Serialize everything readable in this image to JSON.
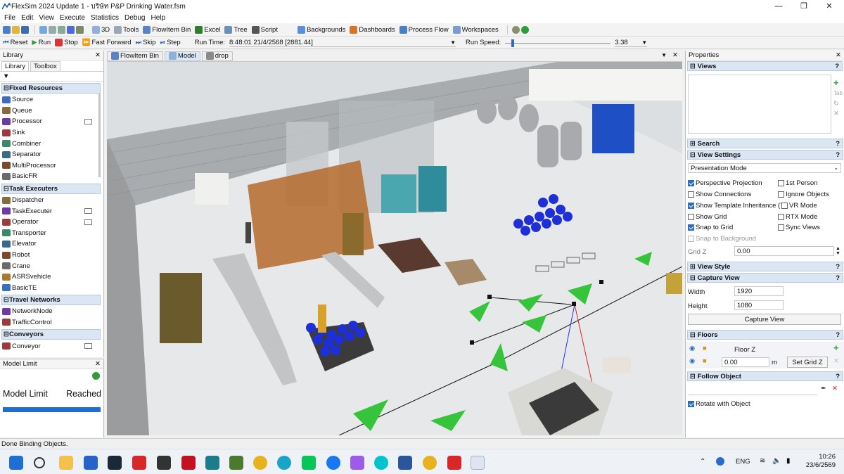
{
  "window": {
    "title": "FlexSim 2024 Update 1 - บริษัท P&P Drinking Water.fsm"
  },
  "menu": [
    "File",
    "Edit",
    "View",
    "Execute",
    "Statistics",
    "Debug",
    "Help"
  ],
  "toolbar1": {
    "items": [
      "3D",
      "Tools",
      "FlowItem Bin",
      "Excel",
      "Tree",
      "Script",
      "Backgrounds",
      "Dashboards",
      "Process Flow",
      "Workspaces"
    ]
  },
  "toolbar2": {
    "reset": "Reset",
    "run": "Run",
    "stop": "Stop",
    "fast_forward": "Fast Forward",
    "skip": "Skip",
    "step": "Step",
    "run_time_label": "Run Time:",
    "run_time_value": "8:48:01  21/4/2568 [2881.44]",
    "run_speed_label": "Run Speed:",
    "run_speed_value": "3.38"
  },
  "library": {
    "title": "Library",
    "tabs": [
      "Library",
      "Toolbox"
    ],
    "groups": [
      {
        "name": "Fixed Resources",
        "items": [
          "Source",
          "Queue",
          "Processor",
          "Sink",
          "Combiner",
          "Separator",
          "MultiProcessor",
          "BasicFR"
        ]
      },
      {
        "name": "Task Executers",
        "items": [
          "Dispatcher",
          "TaskExecuter",
          "Operator",
          "Transporter",
          "Elevator",
          "Robot",
          "Crane",
          "ASRSvehicle",
          "BasicTE"
        ]
      },
      {
        "name": "Travel Networks",
        "items": [
          "NetworkNode",
          "TrafficControl"
        ]
      },
      {
        "name": "Conveyors",
        "items": [
          "Conveyor"
        ]
      }
    ]
  },
  "model_limit": {
    "title": "Model Limit",
    "text_left": "Model Limit",
    "text_right": "Reached"
  },
  "viewport_tabs": [
    "FlowItem Bin",
    "Model",
    "drop"
  ],
  "properties": {
    "title": "Properties",
    "sections": {
      "views": "Views",
      "search": "Search",
      "view_settings": "View Settings",
      "view_style": "View Style",
      "capture_view": "Capture View",
      "floors": "Floors",
      "follow_object": "Follow Object"
    },
    "presentation_mode": "Presentation Mode",
    "checkboxes": {
      "perspective": "Perspective Projection",
      "first_person": "1st Person",
      "show_connections": "Show Connections",
      "ignore_objects": "Ignore Objects",
      "template_inheritance": "Show Template Inheritance (T)",
      "vr_mode": "VR Mode",
      "show_grid": "Show Grid",
      "rtx_mode": "RTX Mode",
      "snap_grid": "Snap to Grid",
      "sync_views": "Sync Views",
      "snap_background": "Snap to Background",
      "rotate_object": "Rotate with Object"
    },
    "grid_z_label": "Grid Z",
    "grid_z_value": "0.00",
    "width_label": "Width",
    "width_value": "1920",
    "height_label": "Height",
    "height_value": "1080",
    "capture_button": "Capture View",
    "floor_label": "Floor Z",
    "floor_value": "0.00",
    "floor_unit": "m",
    "set_grid_button": "Set Grid Z"
  },
  "status": {
    "text": "Done Binding Objects."
  },
  "taskbar": {
    "lang": "ENG",
    "time": "10:26",
    "date": "23/6/2569"
  }
}
